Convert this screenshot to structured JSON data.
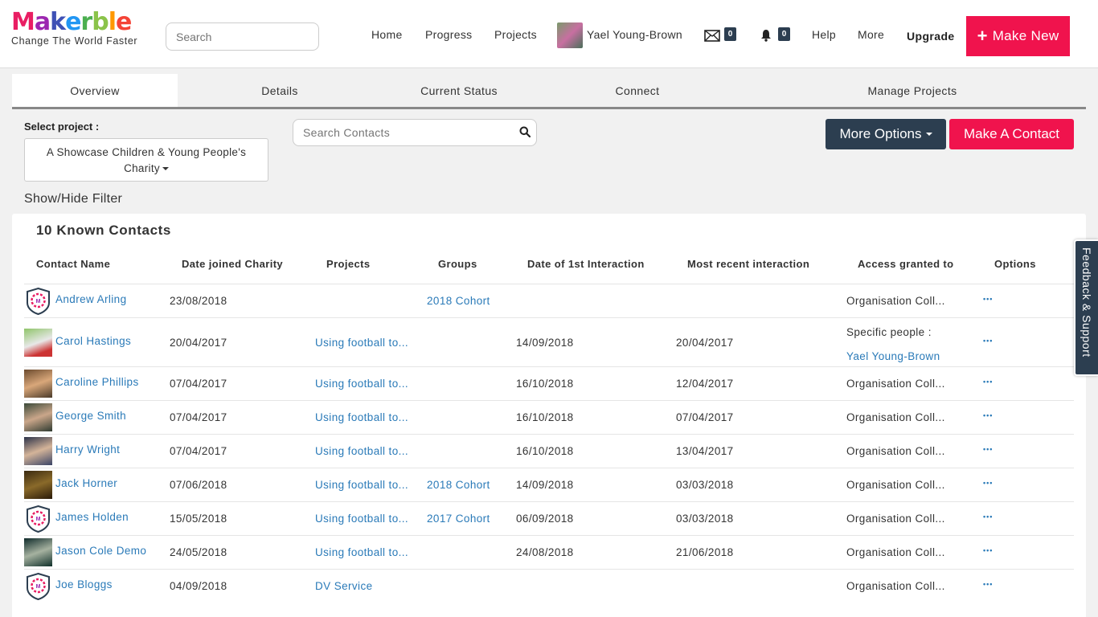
{
  "header": {
    "logo_letters": [
      {
        "ch": "M",
        "color": "#e91e63"
      },
      {
        "ch": "a",
        "color": "#9c27b0"
      },
      {
        "ch": "k",
        "color": "#3f51b5"
      },
      {
        "ch": "e",
        "color": "#2196f3"
      },
      {
        "ch": "r",
        "color": "#4caf50"
      },
      {
        "ch": "b",
        "color": "#8bc34a"
      },
      {
        "ch": "l",
        "color": "#ff9800"
      },
      {
        "ch": "e",
        "color": "#f44336"
      }
    ],
    "tagline": "Change The World Faster",
    "search_placeholder": "Search",
    "nav": {
      "home": "Home",
      "progress": "Progress",
      "projects": "Projects",
      "user": "Yael Young-Brown",
      "help": "Help",
      "more": "More"
    },
    "messages_count": "0",
    "notifications_count": "0",
    "upgrade": "Upgrade",
    "make_new": "Make New"
  },
  "tabs": {
    "overview": "Overview",
    "details": "Details",
    "current_status": "Current Status",
    "connect": "Connect",
    "manage_projects": "Manage Projects"
  },
  "controls": {
    "select_label": "Select project :",
    "select_value_line1": "A Showcase Children & Young People's",
    "select_value_line2": "Charity",
    "search_placeholder": "Search Contacts",
    "more_options": "More Options",
    "make_contact": "Make A Contact",
    "filter": "Show/Hide Filter"
  },
  "table": {
    "title": "10 Known Contacts",
    "headers": {
      "name": "Contact Name",
      "joined": "Date joined Charity",
      "projects": "Projects",
      "groups": "Groups",
      "first": "Date of 1st Interaction",
      "recent": "Most recent interaction",
      "access": "Access granted to",
      "options": "Options"
    },
    "rows": [
      {
        "name": "Andrew Arling",
        "joined": "23/08/2018",
        "projects": "",
        "groups": "2018 Cohort",
        "first": "",
        "recent": "",
        "access": "Organisation Coll...",
        "access2": ""
      },
      {
        "name": "Carol Hastings",
        "joined": "20/04/2017",
        "projects": "Using football to...",
        "groups": "",
        "first": "14/09/2018",
        "recent": "20/04/2017",
        "access": "Specific people :",
        "access2": "Yael Young-Brown"
      },
      {
        "name": "Caroline Phillips",
        "joined": "07/04/2017",
        "projects": "Using football to...",
        "groups": "",
        "first": "16/10/2018",
        "recent": "12/04/2017",
        "access": "Organisation Coll...",
        "access2": ""
      },
      {
        "name": "George Smith",
        "joined": "07/04/2017",
        "projects": "Using football to...",
        "groups": "",
        "first": "16/10/2018",
        "recent": "07/04/2017",
        "access": "Organisation Coll...",
        "access2": ""
      },
      {
        "name": "Harry Wright",
        "joined": "07/04/2017",
        "projects": "Using football to...",
        "groups": "",
        "first": "16/10/2018",
        "recent": "13/04/2017",
        "access": "Organisation Coll...",
        "access2": ""
      },
      {
        "name": "Jack Horner",
        "joined": "07/06/2018",
        "projects": "Using football to...",
        "groups": "2018 Cohort",
        "first": "14/09/2018",
        "recent": "03/03/2018",
        "access": "Organisation Coll...",
        "access2": ""
      },
      {
        "name": "James Holden",
        "joined": "15/05/2018",
        "projects": "Using football to...",
        "groups": "2017 Cohort",
        "first": "06/09/2018",
        "recent": "03/03/2018",
        "access": "Organisation Coll...",
        "access2": ""
      },
      {
        "name": "Jason Cole Demo",
        "joined": "24/05/2018",
        "projects": "Using football to...",
        "groups": "",
        "first": "24/08/2018",
        "recent": "21/06/2018",
        "access": "Organisation Coll...",
        "access2": ""
      },
      {
        "name": "Joe Bloggs",
        "joined": "04/09/2018",
        "projects": "DV Service",
        "groups": "",
        "first": "",
        "recent": "",
        "access": "Organisation Coll...",
        "access2": ""
      }
    ]
  },
  "feedback": "Feedback & Support"
}
